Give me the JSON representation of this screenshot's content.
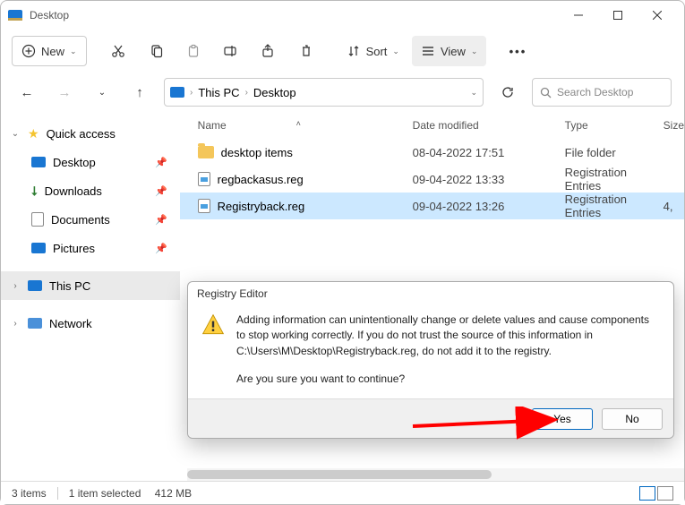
{
  "window": {
    "title": "Desktop"
  },
  "toolbar": {
    "new_label": "New",
    "sort_label": "Sort",
    "view_label": "View"
  },
  "breadcrumb": {
    "root": "This PC",
    "current": "Desktop"
  },
  "search": {
    "placeholder": "Search Desktop"
  },
  "sidebar": {
    "quick_access": "Quick access",
    "desktop": "Desktop",
    "downloads": "Downloads",
    "documents": "Documents",
    "pictures": "Pictures",
    "this_pc": "This PC",
    "network": "Network"
  },
  "columns": {
    "name": "Name",
    "date": "Date modified",
    "type": "Type",
    "size": "Size"
  },
  "files": [
    {
      "name": "desktop items",
      "date": "08-04-2022 17:51",
      "type": "File folder",
      "size": "",
      "kind": "folder",
      "selected": false
    },
    {
      "name": "regbackasus.reg",
      "date": "09-04-2022 13:33",
      "type": "Registration Entries",
      "size": "",
      "kind": "reg",
      "selected": false
    },
    {
      "name": "Registryback.reg",
      "date": "09-04-2022 13:26",
      "type": "Registration Entries",
      "size": "4,",
      "kind": "reg",
      "selected": true
    }
  ],
  "dialog": {
    "title": "Registry Editor",
    "line1": "Adding information can unintentionally change or delete values and cause components to stop working correctly. If you do not trust the source of this information in C:\\Users\\M\\Desktop\\Registryback.reg, do not add it to the registry.",
    "line2": "Are you sure you want to continue?",
    "yes": "Yes",
    "no": "No"
  },
  "status": {
    "count": "3 items",
    "selection": "1 item selected",
    "size": "412 MB"
  }
}
